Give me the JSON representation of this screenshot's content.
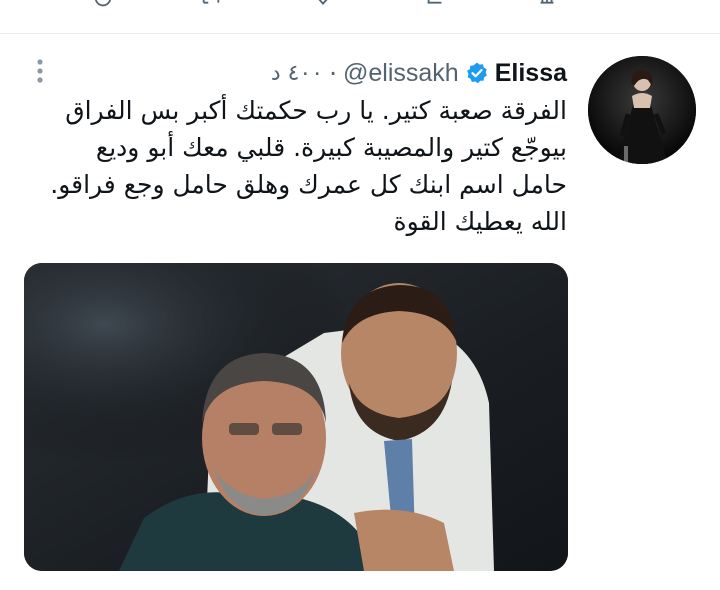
{
  "top_actions": {
    "icons": [
      "reply-icon",
      "retweet-icon",
      "like-icon",
      "share-icon",
      "analytics-icon"
    ]
  },
  "tweet": {
    "display_name": "Elissa",
    "handle": "@elissakh",
    "separator": "·",
    "timestamp": "٤٠٠ د",
    "verified": true,
    "lines": [
      "الفرقة صعبة كتير. يا رب حكمتك أكبر بس الفراق",
      "بيوجّع كتير والمصيبة كبيرة. قلبي معك أبو وديع",
      "حامل اسم ابنك كل عمرك وهلق حامل وجع فراقو.",
      "الله يعطيك القوة"
    ],
    "media": {
      "icon": "photo-two-men"
    }
  },
  "colors": {
    "text_primary": "#0f1419",
    "text_secondary": "#536471",
    "verified_blue": "#1d9bf0",
    "divider": "#e6ecf0"
  }
}
